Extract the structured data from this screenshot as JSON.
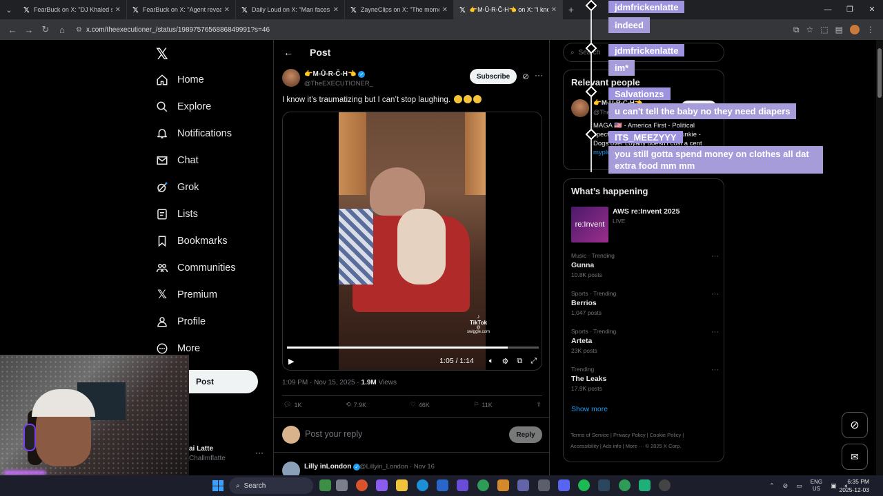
{
  "browser": {
    "tabs": [
      {
        "title": "FearBuck on X: \"DJ Khaled show",
        "active": false
      },
      {
        "title": "FearBuck on X: \"Agent reveals t",
        "active": false
      },
      {
        "title": "Daily Loud on X: \"Man faces hi",
        "active": false
      },
      {
        "title": "ZayneClips on X: \"The moment",
        "active": false
      },
      {
        "title": "👉M-Ū-R-Č-H👈 on X: \"I know",
        "active": true
      }
    ],
    "url": "x.com/theexecutioner_/status/1989757656886849991?s=46"
  },
  "nav": {
    "items": [
      {
        "label": "Home",
        "icon": "home-icon"
      },
      {
        "label": "Explore",
        "icon": "search-icon"
      },
      {
        "label": "Notifications",
        "icon": "bell-icon"
      },
      {
        "label": "Chat",
        "icon": "mail-icon"
      },
      {
        "label": "Grok",
        "icon": "grok-icon"
      },
      {
        "label": "Lists",
        "icon": "list-icon"
      },
      {
        "label": "Bookmarks",
        "icon": "bookmark-icon"
      },
      {
        "label": "Communities",
        "icon": "people-icon"
      },
      {
        "label": "Premium",
        "icon": "x-icon"
      },
      {
        "label": "Profile",
        "icon": "person-icon"
      },
      {
        "label": "More",
        "icon": "more-circle-icon"
      }
    ],
    "post_button": "Post",
    "account": {
      "name": "ai Latte",
      "handle": "Challmflatte"
    }
  },
  "main": {
    "header_title": "Post",
    "author": {
      "name": "👉M-Ū-R-Č-H👈",
      "handle": "@TheEXECUTIONER_"
    },
    "subscribe_label": "Subscribe",
    "text": "I know it’s traumatizing but I can’t stop laughing.",
    "video": {
      "time": "1:05 / 1:14",
      "progress": 0.878,
      "watermark": "TikTok",
      "watermark_sub": "@ swiggle.com"
    },
    "timestamp": "1:09 PM · Nov 15, 2025 · ",
    "views_count": "1.9M",
    "views_label": " Views",
    "stats": {
      "replies": "1K",
      "reposts": "7.9K",
      "likes": "46K",
      "bookmarks": "11K"
    },
    "reply_placeholder": "Post your reply",
    "reply_button": "Reply",
    "next_post": {
      "name": "Lilly inLondon",
      "handle": "@Lillyin_London · Nov 16"
    }
  },
  "right": {
    "search_placeholder": "Search",
    "relevant_title": "Relevant people",
    "relevant_person": {
      "name": "👉M-Ū-R-Č-H👈",
      "handle": "@TheEXECUTIONER_",
      "follow_label": "Follow",
      "bio": "MAGA 🇺🇸 - America First - Political spectator, pundit and political junkie - Dogs over Loyalty doesn't cost a cent",
      "link": "myplugr..."
    },
    "happening_title": "What’s happening",
    "event": {
      "title": "AWS re:Invent 2025",
      "status": "LIVE",
      "thumb_text": "re:Invent"
    },
    "trends": [
      {
        "category": "Music · Trending",
        "name": "Gunna",
        "posts": "10.8K posts"
      },
      {
        "category": "Sports · Trending",
        "name": "Berrios",
        "posts": "1,047 posts"
      },
      {
        "category": "Sports · Trending",
        "name": "Arteta",
        "posts": "23K posts"
      },
      {
        "category": "Trending",
        "name": "The Leaks",
        "posts": "17.9K posts"
      }
    ],
    "show_more": "Show more",
    "footer_line1": "Terms of Service  |  Privacy Policy  |  Cookie Policy  |",
    "footer_line2": "Accessibility  |  Ads info  |  More ···  © 2025 X Corp."
  },
  "chat": [
    {
      "type": "name",
      "text": "jdmfrickenlatte"
    },
    {
      "type": "msg",
      "text": "indeed"
    },
    {
      "type": "name",
      "text": "jdmfrickenlatte"
    },
    {
      "type": "msg",
      "text": "im*"
    },
    {
      "type": "name",
      "text": "Salvationzs"
    },
    {
      "type": "msg",
      "text": "u can't tell the baby no they need diapers"
    },
    {
      "type": "name",
      "text": "ITS_MEEZYYY"
    },
    {
      "type": "msg",
      "text": "you still gotta spend money on clothes all dat extra food mm mm"
    }
  ],
  "taskbar": {
    "search_label": "Search",
    "lang": "ENG",
    "region": "US",
    "time": "6:35 PM",
    "date": "2025-12-03"
  }
}
